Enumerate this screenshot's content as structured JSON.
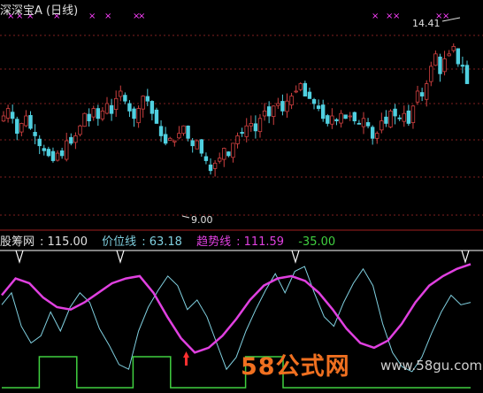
{
  "title": "深深宝A (日线)",
  "indicator": {
    "label": "股筹网",
    "value": "115.00",
    "price_label": "价位线",
    "price_value": "63.18",
    "trend_label": "趋势线",
    "trend_value": "111.59",
    "diff_value": "-35.00"
  },
  "colors": {
    "up": "#d04040",
    "down": "#50d0e0",
    "trend": "#e040e0",
    "price": "#80d0e0",
    "signal": "#40d040",
    "grid": "#802020",
    "marker": "#ff40ff"
  },
  "watermark": {
    "logo": "58公式网",
    "url": "www.58gu.com"
  },
  "chart_data": [
    {
      "type": "candlestick",
      "title": "深深宝A (日线)",
      "annotations": [
        {
          "text": "14.41",
          "kind": "high"
        },
        {
          "text": "9.00",
          "kind": "low"
        }
      ],
      "ylim": [
        8.0,
        15.2
      ],
      "closes": [
        11.6,
        11.9,
        11.5,
        10.9,
        11.3,
        11.6,
        11.1,
        10.8,
        10.4,
        10.2,
        10.0,
        9.8,
        10.1,
        10.0,
        10.6,
        10.5,
        10.8,
        11.2,
        11.7,
        11.4,
        11.9,
        11.5,
        11.8,
        12.1,
        11.7,
        12.3,
        12.6,
        12.2,
        11.8,
        11.5,
        11.9,
        12.4,
        12.2,
        11.7,
        11.3,
        10.8,
        10.5,
        10.7,
        10.6,
        10.9,
        11.2,
        10.7,
        10.4,
        10.6,
        10.1,
        9.8,
        9.4,
        9.7,
        9.9,
        10.3,
        10.0,
        10.5,
        10.8,
        10.9,
        11.2,
        11.3,
        11.0,
        11.5,
        11.8,
        11.6,
        12.0,
        12.1,
        11.8,
        12.2,
        12.4,
        12.6,
        12.9,
        12.4,
        12.3,
        12.1,
        11.9,
        11.5,
        11.3,
        11.6,
        11.4,
        11.7,
        11.5,
        11.6,
        11.4,
        11.3,
        11.5,
        11.2,
        10.7,
        10.9,
        11.4,
        11.3,
        11.8,
        11.6,
        11.5,
        11.7,
        11.3,
        12.0,
        12.6,
        12.4,
        12.9,
        13.6,
        14.1,
        13.3,
        13.9,
        14.1,
        14.4,
        13.7,
        13.6,
        12.9
      ],
      "volume_like_markers": [
        "x",
        "x",
        "x",
        "x",
        "x",
        "x",
        "x",
        "x"
      ]
    },
    {
      "type": "line",
      "series": [
        {
          "name": "价位线",
          "values": [
            62,
            72,
            44,
            30,
            36,
            56,
            40,
            60,
            72,
            64,
            42,
            28,
            12,
            8,
            40,
            60,
            74,
            86,
            78,
            58,
            66,
            52,
            30,
            8,
            18,
            40,
            58,
            74,
            88,
            72,
            90,
            94,
            72,
            52,
            44,
            64,
            80,
            92,
            78,
            46,
            22,
            10,
            6,
            18,
            38,
            56,
            70,
            62,
            64
          ]
        },
        {
          "name": "趋势线",
          "values": [
            70,
            84,
            80,
            68,
            60,
            58,
            64,
            72,
            80,
            84,
            86,
            72,
            52,
            34,
            22,
            26,
            36,
            50,
            66,
            78,
            84,
            86,
            82,
            72,
            58,
            42,
            30,
            26,
            32,
            46,
            64,
            78,
            86,
            92,
            96
          ]
        },
        {
          "name": "股筹网",
          "values": [
            0,
            0,
            1,
            1,
            0,
            0,
            0,
            1,
            1,
            0,
            0,
            0,
            0,
            1,
            1,
            0,
            0,
            0,
            0,
            0,
            0,
            0,
            0,
            0,
            0,
            0
          ]
        }
      ]
    }
  ]
}
